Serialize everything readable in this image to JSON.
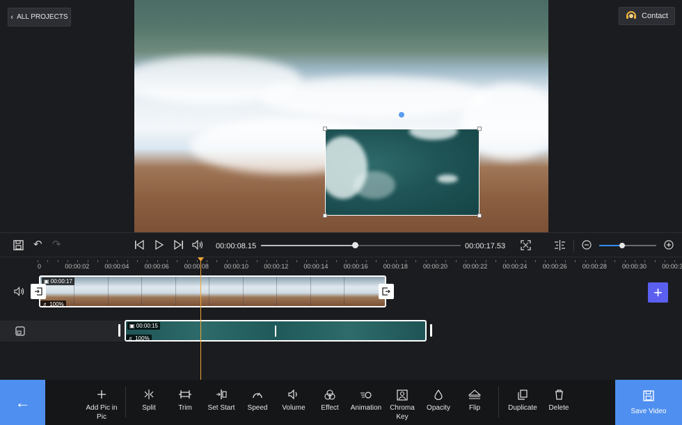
{
  "header": {
    "all_projects_label": "ALL PROJECTS",
    "contact_label": "Contact"
  },
  "transport": {
    "current_time": "00:00:08.15",
    "total_time": "00:00:17.53",
    "seek_progress": 0.47,
    "zoom_level": 0.4
  },
  "timeline": {
    "ruler": [
      "0",
      "00:00:02",
      "00:00:04",
      "00:00:06",
      "00:00:08",
      "00:00:10",
      "00:00:12",
      "00:00:14",
      "00:00:16",
      "00:00:18",
      "00:00:20",
      "00:00:22",
      "00:00:24",
      "00:00:26",
      "00:00:28",
      "00:00:30",
      "00:00:3"
    ],
    "main_clip": {
      "duration": "00:00:17",
      "volume": "100%"
    },
    "pip_clip": {
      "duration": "00:00:15",
      "volume": "100%"
    }
  },
  "toolbar": {
    "tools": [
      {
        "name": "add-pic-in-pic",
        "label": "Add Pic in Pic",
        "icon": "plus-icon"
      },
      {
        "name": "split",
        "label": "Split",
        "icon": "split-icon"
      },
      {
        "name": "trim",
        "label": "Trim",
        "icon": "trim-icon"
      },
      {
        "name": "set-start",
        "label": "Set Start",
        "icon": "set-start-icon"
      },
      {
        "name": "speed",
        "label": "Speed",
        "icon": "speed-icon"
      },
      {
        "name": "volume",
        "label": "Volume",
        "icon": "volume-icon"
      },
      {
        "name": "effect",
        "label": "Effect",
        "icon": "effect-icon"
      },
      {
        "name": "animation",
        "label": "Animation",
        "icon": "animation-icon"
      },
      {
        "name": "chroma-key",
        "label": "Chroma Key",
        "icon": "chroma-key-icon"
      },
      {
        "name": "opacity",
        "label": "Opacity",
        "icon": "opacity-icon"
      },
      {
        "name": "flip",
        "label": "Flip",
        "icon": "flip-icon"
      },
      {
        "name": "duplicate",
        "label": "Duplicate",
        "icon": "duplicate-icon"
      },
      {
        "name": "delete",
        "label": "Delete",
        "icon": "delete-icon"
      }
    ],
    "save_label": "Save Video"
  },
  "colors": {
    "accent": "#4f8fef",
    "playhead": "#f2a531",
    "add_track": "#5b5ff0",
    "zoom_fill": "#2f8ff0"
  }
}
